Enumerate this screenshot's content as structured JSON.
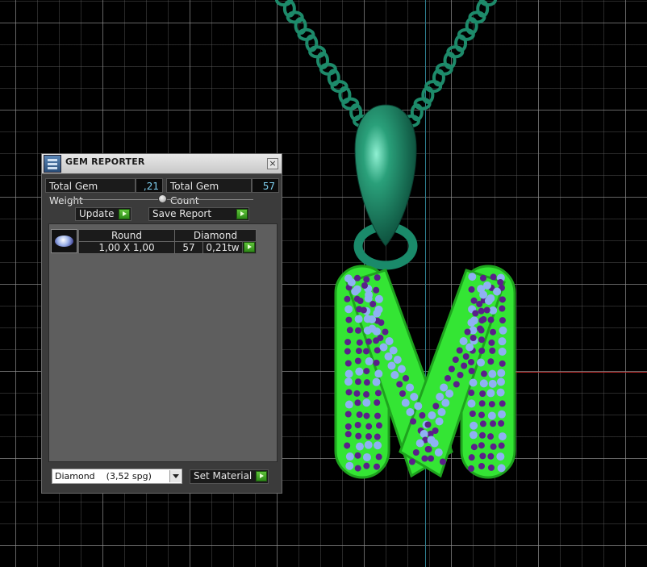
{
  "panel": {
    "title": "GEM REPORTER",
    "close_glyph": "×",
    "total_weight_label": "Total Gem Weight",
    "total_weight_value": ",21",
    "total_count_label": "Total Gem Count",
    "total_count_value": "57",
    "update_label": "Update",
    "save_report_label": "Save Report",
    "rows": [
      {
        "shape": "Round",
        "size": "1,00 X 1,00",
        "material": "Diamond",
        "count": "57",
        "weight": "0,21tw"
      }
    ],
    "material_select": "Diamond    (3,52 spg)",
    "set_material_label": "Set Material"
  },
  "colors": {
    "gem_purple": "#5a1f8a",
    "gem_blue": "#8fb1f3",
    "metal_green": "#2bdc2b",
    "chain_green": "#1d8a6a"
  },
  "icons": [
    "gem-reporter-icon",
    "close-icon",
    "play-icon",
    "round-gem-icon",
    "dropdown-arrow-icon"
  ]
}
